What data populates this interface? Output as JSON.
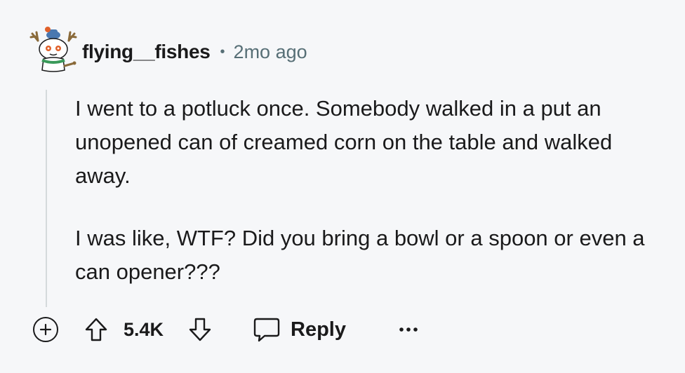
{
  "comment": {
    "author": {
      "username": "flying__fishes",
      "avatar_icon": "snoo-avatar-icon"
    },
    "separator": "•",
    "timestamp": "2mo ago",
    "paragraphs": [
      "I went to a potluck once. Somebody walked in a put an unopened can of creamed corn on the table and walked away.",
      "I was like, WTF? Did you bring a bowl or a spoon or even a can opener???"
    ],
    "actions": {
      "expand_icon": "plus-circle-icon",
      "upvote_icon": "upvote-arrow-icon",
      "score": "5.4K",
      "downvote_icon": "downvote-arrow-icon",
      "reply_icon": "speech-bubble-icon",
      "reply_label": "Reply",
      "more_icon": "more-dots-icon"
    }
  },
  "colors": {
    "background": "#f6f7f9",
    "text": "#1a1a1b",
    "meta": "#576f76",
    "thread_line": "#d5dadc"
  }
}
